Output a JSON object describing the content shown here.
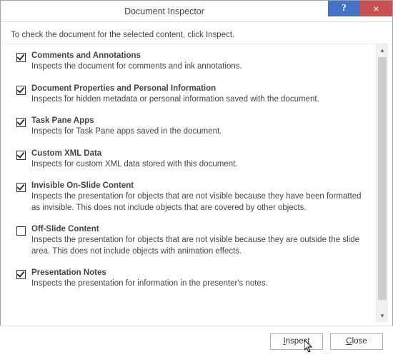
{
  "window": {
    "title": "Document Inspector"
  },
  "instruction": "To check the document for the selected content, click Inspect.",
  "items": [
    {
      "checked": true,
      "title": "Comments and Annotations",
      "desc": "Inspects the document for comments and ink annotations."
    },
    {
      "checked": true,
      "title": "Document Properties and Personal Information",
      "desc": "Inspects for hidden metadata or personal information saved with the document."
    },
    {
      "checked": true,
      "title": "Task Pane Apps",
      "desc": "Inspects for Task Pane apps saved in the document."
    },
    {
      "checked": true,
      "title": "Custom XML Data",
      "desc": "Inspects for custom XML data stored with this document."
    },
    {
      "checked": true,
      "title": "Invisible On-Slide Content",
      "desc": "Inspects the presentation for objects that are not visible because they have been formatted as invisible. This does not include objects that are covered by other objects."
    },
    {
      "checked": false,
      "title": "Off-Slide Content",
      "desc": "Inspects the presentation for objects that are not visible because they are outside the slide area.  This does not include objects with animation effects."
    },
    {
      "checked": true,
      "title": "Presentation Notes",
      "desc": "Inspects the presentation for information in the presenter's notes."
    }
  ],
  "buttons": {
    "inspect_prefix": "",
    "inspect_ul": "I",
    "inspect_suffix": "nspect",
    "close_prefix": "",
    "close_ul": "C",
    "close_suffix": "lose"
  }
}
